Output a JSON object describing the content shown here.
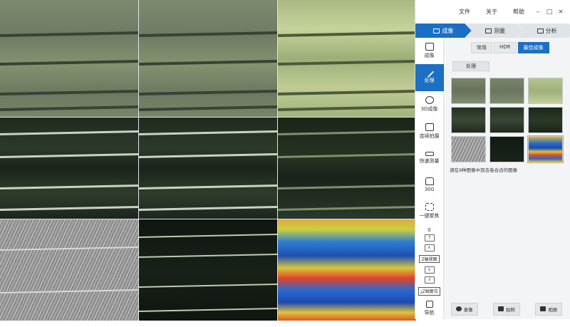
{
  "menu": {
    "file": "文件",
    "about": "关于",
    "help": "帮助",
    "minimize": "–",
    "maximize": "□",
    "close": "×"
  },
  "mode_tabs": [
    {
      "label": "成像",
      "active": true
    },
    {
      "label": "测量",
      "active": false
    },
    {
      "label": "分析",
      "active": false
    }
  ],
  "toolbar": {
    "items": [
      {
        "label": "成像",
        "icon": "image-icon"
      },
      {
        "label": "处理",
        "icon": "wand-icon",
        "active": true
      },
      {
        "label": "3D成像",
        "icon": "cube-icon"
      },
      {
        "label": "连续拍摄",
        "icon": "burst-icon"
      },
      {
        "label": "快速测量",
        "icon": "ruler-icon"
      },
      {
        "label": "300",
        "icon": "lens-icon"
      },
      {
        "label": "一键聚焦",
        "icon": "focus-icon"
      }
    ],
    "z_value": "0",
    "z_view_label": "Z轴视图",
    "z_reset_label": "Z轴复位",
    "nav_label": "导航"
  },
  "subtabs": [
    {
      "label": "常用",
      "active": false
    },
    {
      "label": "HDR",
      "active": false
    },
    {
      "label": "最佳成像",
      "active": true
    }
  ],
  "process_button": "处理",
  "hint": "请在9种图像中双击卷合适的图像",
  "bottom": {
    "record": "录像",
    "snapshot": "拍照",
    "album": "相册"
  },
  "colors": {
    "accent": "#1c6fc4"
  }
}
